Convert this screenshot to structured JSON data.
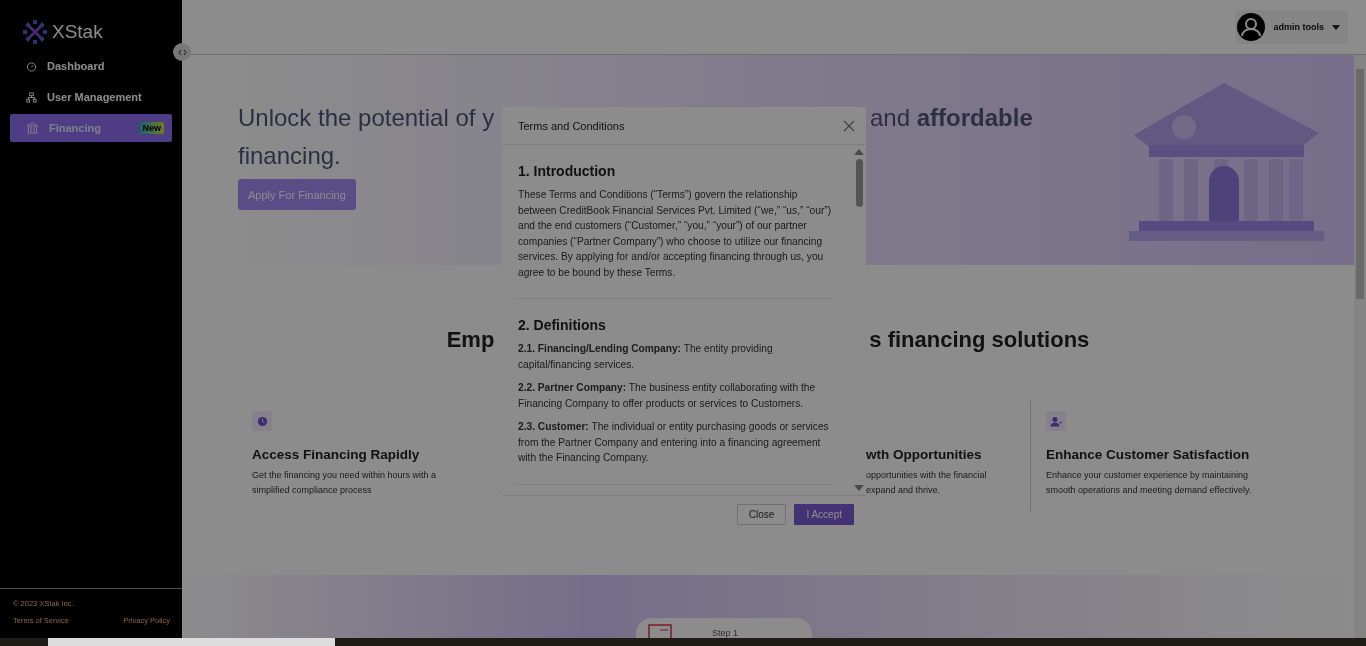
{
  "brand": {
    "name": "XStak"
  },
  "sidebar": {
    "items": [
      {
        "label": "Dashboard",
        "selected": false
      },
      {
        "label": "User Management",
        "selected": false
      },
      {
        "label": "Financing",
        "selected": true,
        "badge": "New"
      }
    ],
    "footer": {
      "copyright": "© 2023 XStak Inc.",
      "links": [
        "Terms of Service",
        "Privacy Policy"
      ]
    }
  },
  "header": {
    "user": "admin tools"
  },
  "hero": {
    "title_left": "Unlock the potential of y",
    "title_right": "and **affordable**",
    "title_line2": "financing.",
    "button": "Apply For Financing"
  },
  "section": {
    "title_left": "Emp",
    "title_right": "s financing solutions"
  },
  "features": [
    {
      "title": "Access Financing Rapidly",
      "lines": [
        "Get the financing you need within hours with a",
        "simplified compliance process"
      ],
      "kind": "full"
    },
    {
      "title": "wth Opportunities",
      "kind": "partial",
      "lines": [
        "opportunities with the financial",
        "expand and thrive."
      ]
    },
    {
      "title": "Enhance Customer Satisfaction",
      "lines": [
        "Enhance your customer experience by maintaining",
        "smooth operations and meeting demand effectively."
      ],
      "kind": "full"
    }
  ],
  "steps": [
    {
      "label": "Step 1"
    }
  ],
  "modal": {
    "title": "Terms and Conditions",
    "sections": [
      {
        "heading": "1. Introduction",
        "paragraphs": [
          "These Terms and Conditions (“Terms”) govern the relationship between CreditBook Financial Services Pvt. Limited (“we,” “us,” “our”) and the end customers (“Customer,” “you,” “your”) of our partner companies (“Partner Company”) who choose to utilize our financing services. By applying for and/or accepting financing through us, you agree to be bound by these Terms."
        ]
      },
      {
        "heading": "2. Definitions",
        "paragraphs": [
          "**2.1. Financing/Lending Company:** The entity providing capital/financing services.",
          "**2.2. Partner Company:** The business entity collaborating with the Financing Company to offer products or services to Customers.",
          "**2.3. Customer:** The individual or entity purchasing goods or services from the Partner Company and entering into a financing agreement with the Financing Company."
        ]
      }
    ],
    "buttons": [
      {
        "label": "Close",
        "kind": "secondary"
      },
      {
        "label": "I Accept",
        "kind": "primary"
      }
    ]
  }
}
